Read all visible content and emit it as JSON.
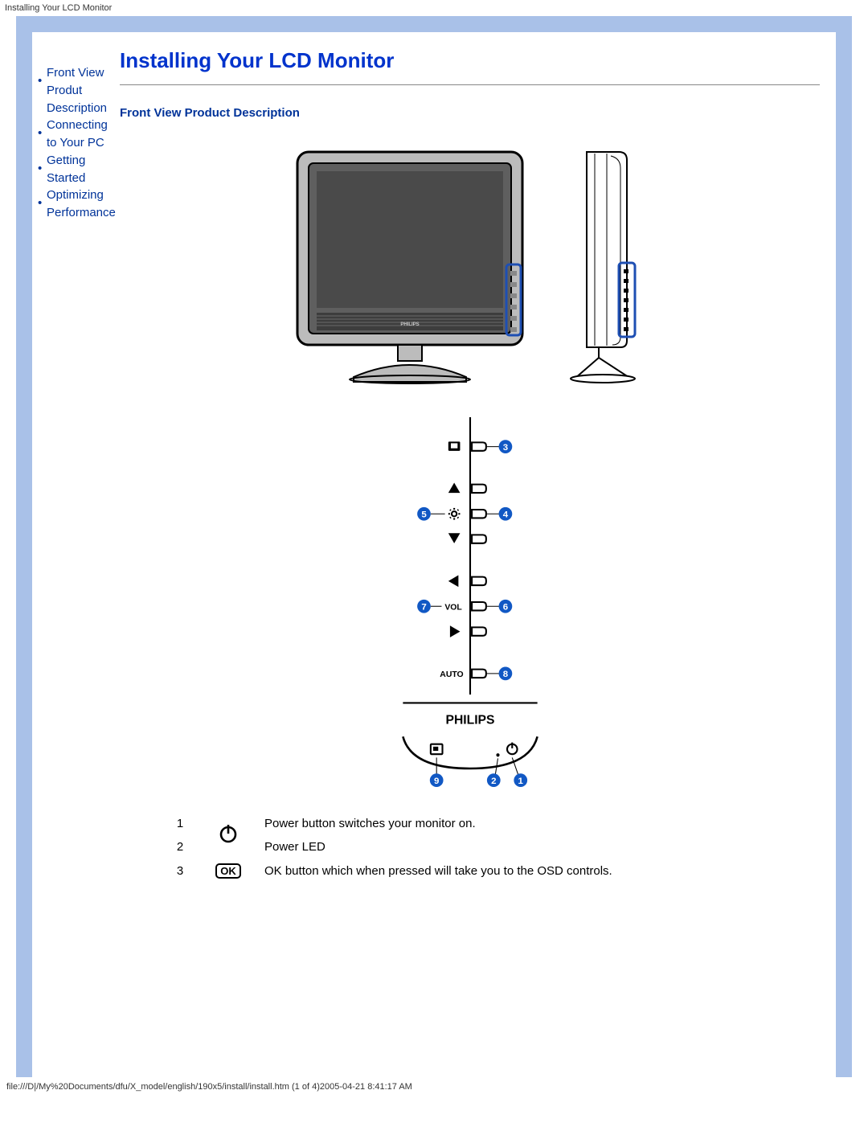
{
  "header_title": "Installing Your LCD Monitor",
  "sidebar": {
    "items": [
      {
        "label": "Front View Produt Description"
      },
      {
        "label": "Connecting to Your PC"
      },
      {
        "label": "Getting Started"
      },
      {
        "label": "Optimizing Performance"
      }
    ]
  },
  "main": {
    "title": "Installing Your LCD Monitor",
    "section_title": "Front View Product Description",
    "brand": "PHILIPS",
    "button_panel": {
      "labels": {
        "vol": "VOL",
        "auto": "AUTO"
      },
      "callouts": [
        1,
        2,
        3,
        4,
        5,
        6,
        7,
        8,
        9
      ]
    },
    "descriptions": [
      {
        "num": "1",
        "icon": "power",
        "text": "Power button switches your monitor on."
      },
      {
        "num": "2",
        "icon": "",
        "text": "Power LED"
      },
      {
        "num": "3",
        "icon": "ok",
        "text": "OK button which when pressed will take you to the OSD controls."
      }
    ]
  },
  "footer": "file:///D|/My%20Documents/dfu/X_model/english/190x5/install/install.htm (1 of 4)2005-04-21 8:41:17 AM"
}
